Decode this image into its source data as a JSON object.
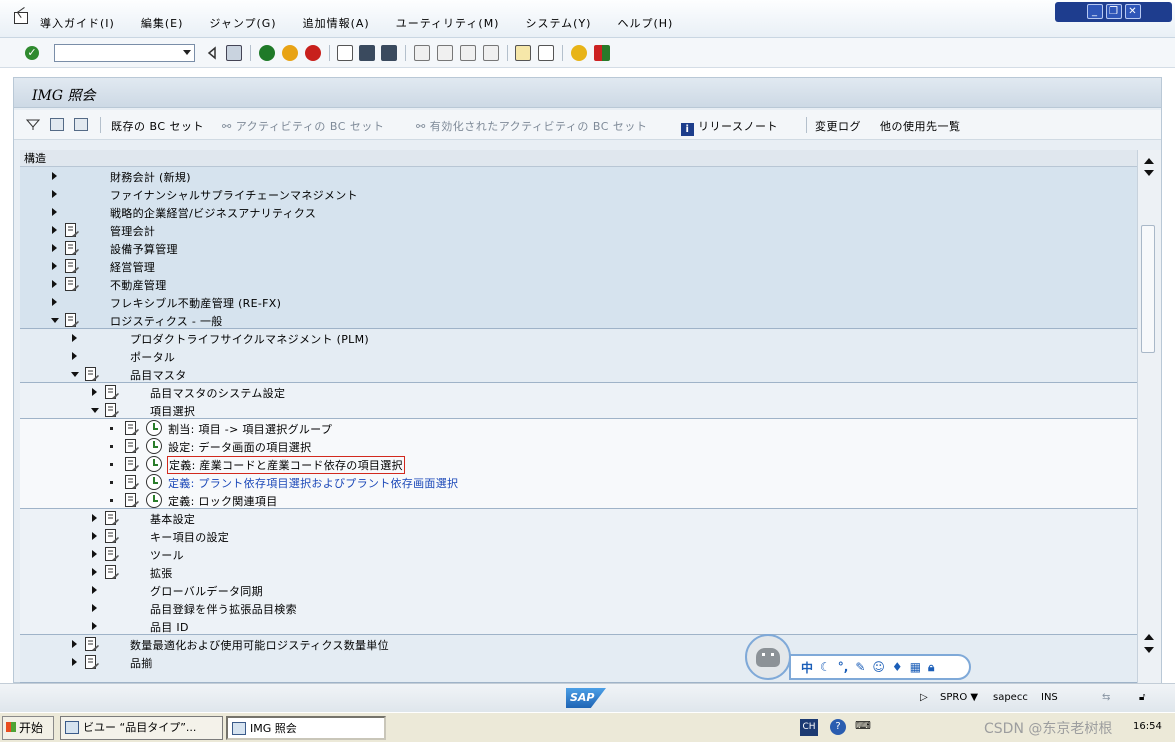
{
  "menubar": {
    "items": [
      "導入ガイド(I)",
      "編集(E)",
      "ジャンプ(G)",
      "追加情報(A)",
      "ユーティリティ(M)",
      "システム(Y)",
      "ヘルプ(H)"
    ]
  },
  "window_controls": [
    "minimize",
    "restore",
    "close"
  ],
  "toolbar": {
    "command_field_value": ""
  },
  "screen": {
    "title": "IMG 照会",
    "app_toolbar": {
      "existing_bc_sets": "既存の BC セット",
      "activity_bc_sets": "アクティビティの BC セット",
      "activated_bc_sets": "有効化されたアクティビティの BC セット",
      "release_notes": "リリースノート",
      "change_log": "変更ログ",
      "where_used": "他の使用先一覧"
    },
    "tree_header": "構造"
  },
  "tree": {
    "rows": [
      {
        "label": "財務会計 (新規)",
        "level": 0,
        "expander": "collapsed",
        "doc": false
      },
      {
        "label": "ファイナンシャルサプライチェーンマネジメント",
        "level": 0,
        "expander": "collapsed",
        "doc": false
      },
      {
        "label": "戦略的企業経営/ビジネスアナリティクス",
        "level": 0,
        "expander": "collapsed",
        "doc": false
      },
      {
        "label": "管理会計",
        "level": 0,
        "expander": "collapsed",
        "doc": true
      },
      {
        "label": "設備予算管理",
        "level": 0,
        "expander": "collapsed",
        "doc": true
      },
      {
        "label": "経営管理",
        "level": 0,
        "expander": "collapsed",
        "doc": true
      },
      {
        "label": "不動産管理",
        "level": 0,
        "expander": "collapsed",
        "doc": true
      },
      {
        "label": "フレキシブル不動産管理 (RE-FX)",
        "level": 0,
        "expander": "collapsed",
        "doc": false
      },
      {
        "label": "ロジスティクス - 一般",
        "level": 0,
        "expander": "expanded",
        "doc": true
      },
      {
        "label": "プロダクトライフサイクルマネジメント (PLM)",
        "level": 1,
        "expander": "collapsed",
        "doc": false
      },
      {
        "label": "ポータル",
        "level": 1,
        "expander": "collapsed",
        "doc": false
      },
      {
        "label": "品目マスタ",
        "level": 1,
        "expander": "expanded",
        "doc": true
      },
      {
        "label": "品目マスタのシステム設定",
        "level": 2,
        "expander": "collapsed",
        "doc": true
      },
      {
        "label": "項目選択",
        "level": 2,
        "expander": "expanded",
        "doc": true
      },
      {
        "label": "割当: 項目 -> 項目選択グループ",
        "level": 3,
        "expander": "leaf",
        "doc": true,
        "exec": true
      },
      {
        "label": "設定: データ画面の項目選択",
        "level": 3,
        "expander": "leaf",
        "doc": true,
        "exec": true
      },
      {
        "label": "定義: 産業コードと産業コード依存の項目選択",
        "level": 3,
        "expander": "leaf",
        "doc": true,
        "exec": true,
        "selected": true
      },
      {
        "label": "定義: プラント依存項目選択およびプラント依存画面選択",
        "level": 3,
        "expander": "leaf",
        "doc": true,
        "exec": true,
        "link": true
      },
      {
        "label": "定義: ロック関連項目",
        "level": 3,
        "expander": "leaf",
        "doc": true,
        "exec": true
      },
      {
        "label": "基本設定",
        "level": 2,
        "expander": "collapsed",
        "doc": true
      },
      {
        "label": "キー項目の設定",
        "level": 2,
        "expander": "collapsed",
        "doc": true
      },
      {
        "label": "ツール",
        "level": 2,
        "expander": "collapsed",
        "doc": true
      },
      {
        "label": "拡張",
        "level": 2,
        "expander": "collapsed",
        "doc": true
      },
      {
        "label": "グローバルデータ同期",
        "level": 2,
        "expander": "collapsed",
        "doc": false
      },
      {
        "label": "品目登録を伴う拡張品目検索",
        "level": 2,
        "expander": "collapsed",
        "doc": false
      },
      {
        "label": "品目 ID",
        "level": 2,
        "expander": "collapsed",
        "doc": false
      },
      {
        "label": "数量最適化および使用可能ロジスティクス数量単位",
        "level": 1,
        "expander": "collapsed",
        "doc": true
      },
      {
        "label": "品揃",
        "level": 1,
        "expander": "collapsed",
        "doc": true
      }
    ]
  },
  "ime_bar": {
    "mode": "中"
  },
  "statusbar": {
    "transaction": "SPRO",
    "server": "sapecc",
    "insert_mode": "INS"
  },
  "taskbar": {
    "start": "开始",
    "tasks": [
      "ビユー “品目タイプ”...",
      "IMG 照会"
    ],
    "lang": "CH",
    "watermark": "CSDN @东京老树根",
    "time": "16:54"
  }
}
